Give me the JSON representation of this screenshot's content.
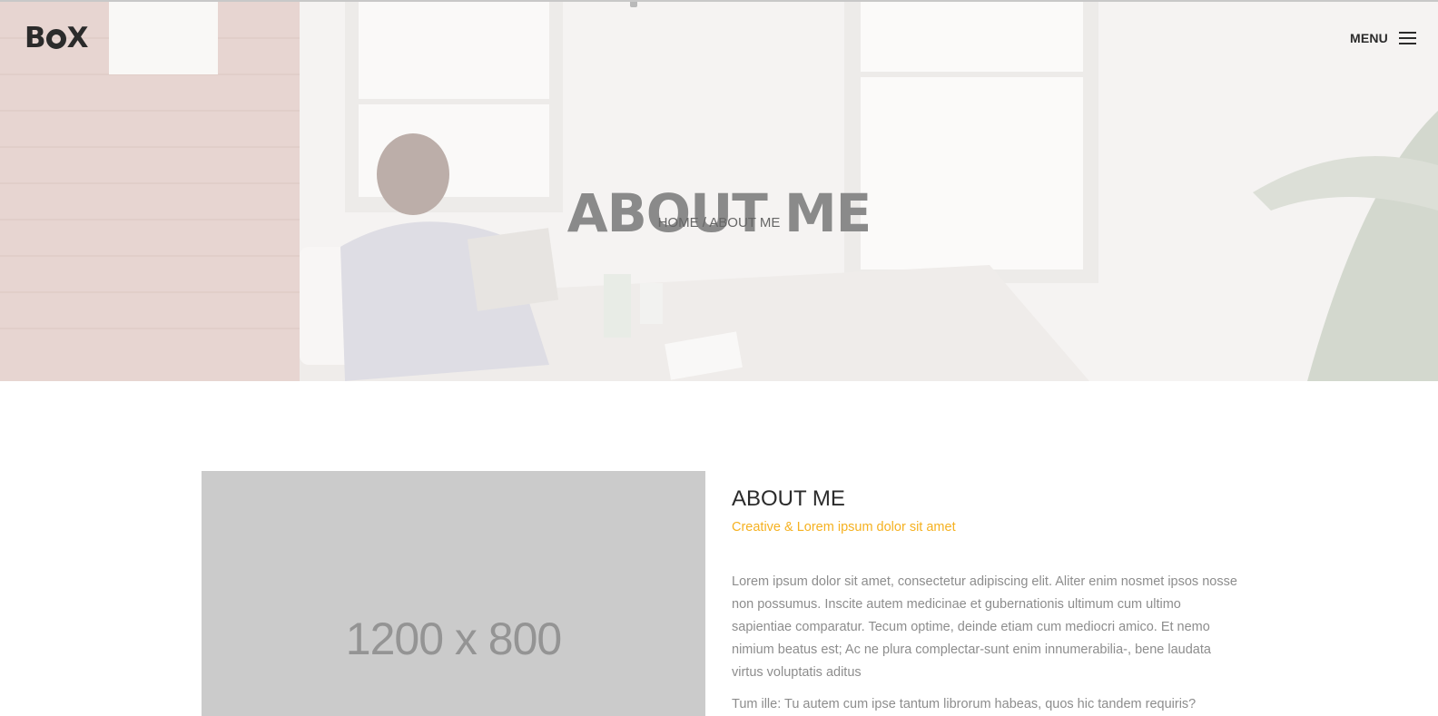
{
  "header": {
    "logo_text_start": "B",
    "logo_text_end": "X",
    "menu_label": "MENU"
  },
  "hero": {
    "title": "ABOUT ME",
    "breadcrumb": {
      "home": "HOME",
      "separator": "/",
      "current": "ABOUT ME"
    }
  },
  "content": {
    "image_placeholder_label": "1200 x 800",
    "heading": "ABOUT ME",
    "subtitle": "Creative & Lorem ipsum dolor sit amet",
    "paragraphs": [
      "Lorem ipsum dolor sit amet, consectetur adipiscing elit. Aliter enim nosmet ipsos nosse non possumus. Inscite autem medicinae et gubernationis ultimum cum ultimo sapientiae comparatur. Tecum optime, deinde etiam cum mediocri amico. Et nemo nimium beatus est; Ac ne plura complectar-sunt enim innumerabilia-, bene laudata virtus voluptatis aditus",
      "Tum ille: Tu autem cum ipse tantum librorum habeas, quos hic tandem requiris?"
    ]
  },
  "colors": {
    "accent": "#f5b120",
    "text_dark": "#2b2b2b",
    "text_muted": "#8d8d8d",
    "placeholder_bg": "#cbcbcb"
  },
  "icons": {
    "menu": "hamburger-icon"
  }
}
